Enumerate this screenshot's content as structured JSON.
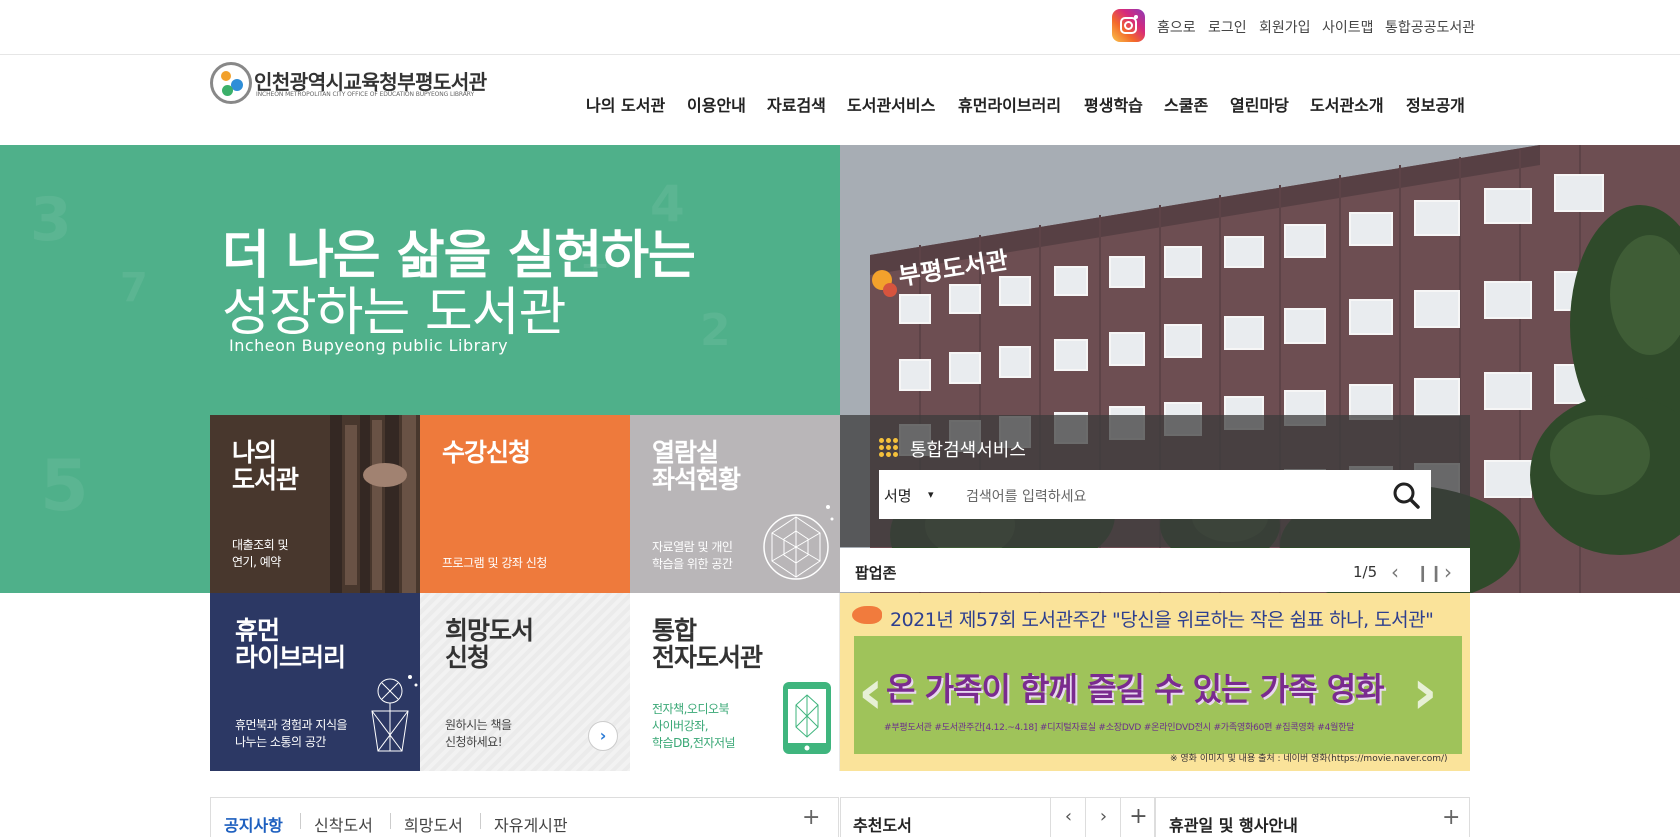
{
  "topbar": {
    "instagram_icon": "instagram-icon",
    "links": [
      "홈으로",
      "로그인",
      "회원가입",
      "사이트맵",
      "통합공공도서관"
    ]
  },
  "logo": {
    "title": "인천광역시교육청부평도서관",
    "subtitle": "INCHEON METROPOLITAN CITY OFFICE OF EDUCATION BUPYEONG LIBRARY"
  },
  "nav": [
    "나의 도서관",
    "이용안내",
    "자료검색",
    "도서관서비스",
    "휴먼라이브러리",
    "평생학습",
    "스쿨존",
    "열린마당",
    "도서관소개",
    "정보공개"
  ],
  "hero": {
    "line1": "더 나은 삶을 실현하는",
    "line2": "성장하는 도서관",
    "english": "Incheon Bupyeong public Library",
    "building_sign": "부평도서관"
  },
  "tiles": [
    {
      "title1": "나의",
      "title2": "도서관",
      "desc1": "대출조회 및",
      "desc2": "연기, 예약"
    },
    {
      "title1": "수강신청",
      "title2": "",
      "desc1": "프로그램 및 강좌 신청",
      "desc2": ""
    },
    {
      "title1": "열람실",
      "title2": "좌석현황",
      "desc1": "자료열람 및 개인",
      "desc2": "학습을 위한 공간"
    },
    {
      "title1": "휴먼",
      "title2": "라이브러리",
      "desc1": "휴먼북과 경험과 지식을",
      "desc2": "나누는 소통의 공간"
    },
    {
      "title1": "희망도서",
      "title2": "신청",
      "desc1": "원하시는 책을",
      "desc2": "신청하세요!"
    },
    {
      "title1": "통합",
      "title2": "전자도서관",
      "desc1": "전자책,오디오북",
      "desc2": "사이버강좌,",
      "desc3": "학습DB,전자저널"
    }
  ],
  "search": {
    "title": "통합검색서비스",
    "select_value": "서명",
    "placeholder": "검색어를 입력하세요"
  },
  "popup": {
    "title": "팝업존",
    "counter": "1/5",
    "banner_top": "2021년 제57회 도서관주간  \"당신을 위로하는 작은 쉼표 하나, 도서관\"",
    "banner_main": "온 가족이 함께 즐길 수 있는 가족 영화",
    "banner_tags": "#부평도서관  #도서관주간[4.12.~4.18]  #디지털자료실  #소장DVD  #온라인DVD전시  #가족영화60편  #집콕영화  #4월한달",
    "banner_source": "※ 영화 이미지 및 내용 출처 : 네이버 영화(https://movie.naver.com/)"
  },
  "bottom": {
    "notice_tabs": [
      "공지사항",
      "신착도서",
      "희망도서",
      "자유게시판"
    ],
    "recommend_title": "추천도서",
    "holiday_title": "휴관일 및 행사안내"
  },
  "colors": {
    "hero_green": "#4fb08a",
    "tile_orange": "#ee7a3c",
    "tile_navy": "#2c3864",
    "tile_gray": "#b9b6b8",
    "active_tab": "#1d5fbf"
  }
}
